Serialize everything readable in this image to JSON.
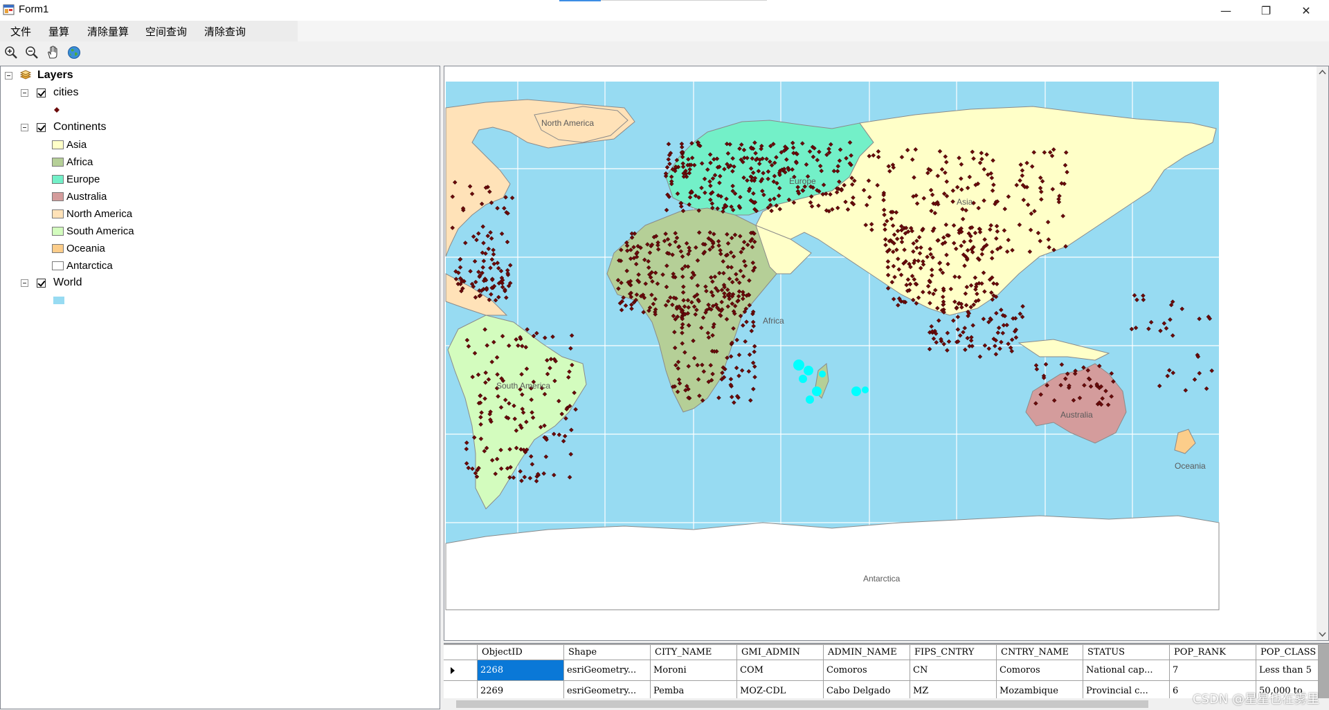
{
  "window": {
    "title": "Form1",
    "minimize_glyph": "—",
    "maximize_glyph": "❐",
    "close_glyph": "✕"
  },
  "menu": [
    "文件",
    "量算",
    "清除量算",
    "空间查询",
    "清除查询"
  ],
  "toolbar": {
    "tools": [
      "zoom-in-icon",
      "zoom-out-icon",
      "pan-hand-icon",
      "full-extent-globe-icon"
    ]
  },
  "toc": {
    "root_label": "Layers",
    "layers": [
      {
        "name": "cities",
        "checked": true,
        "legend": [
          {
            "label": "",
            "color": "#6b0a0a",
            "symbol": "point"
          }
        ]
      },
      {
        "name": "Continents",
        "checked": true,
        "legend": [
          {
            "label": "Asia",
            "color": "#ffffc8"
          },
          {
            "label": "Africa",
            "color": "#b5cf97"
          },
          {
            "label": "Europe",
            "color": "#73f0c8"
          },
          {
            "label": "Australia",
            "color": "#d49c9c"
          },
          {
            "label": "North America",
            "color": "#ffe2b8"
          },
          {
            "label": "South America",
            "color": "#d3fcbe"
          },
          {
            "label": "Oceania",
            "color": "#fccd8a"
          },
          {
            "label": "Antarctica",
            "color": "#ffffff"
          }
        ]
      },
      {
        "name": "World",
        "checked": true,
        "legend": [
          {
            "label": "",
            "color": "#97dbf2"
          }
        ]
      }
    ]
  },
  "map": {
    "ocean_color": "#97dbf2",
    "labels": {
      "north_america": "North America",
      "europe": "Europe",
      "asia": "Asia",
      "africa": "Africa",
      "south_america": "South America",
      "australia": "Australia",
      "oceania": "Oceania",
      "antarctica": "Antarctica"
    }
  },
  "grid": {
    "columns": [
      "ObjectID",
      "Shape",
      "CITY_NAME",
      "GMI_ADMIN",
      "ADMIN_NAME",
      "FIPS_CNTRY",
      "CNTRY_NAME",
      "STATUS",
      "POP_RANK",
      "POP_CLASS"
    ],
    "rows": [
      [
        "2268",
        "esriGeometry...",
        "Moroni",
        "COM",
        "Comoros",
        "CN",
        "Comoros",
        "National cap...",
        "7",
        "Less than 5"
      ],
      [
        "2269",
        "esriGeometry...",
        "Pemba",
        "MOZ-CDL",
        "Cabo Delgado",
        "MZ",
        "Mozambique",
        "Provincial c...",
        "6",
        "50,000 to"
      ]
    ]
  },
  "watermark": "CSDN @星星也在雾里"
}
